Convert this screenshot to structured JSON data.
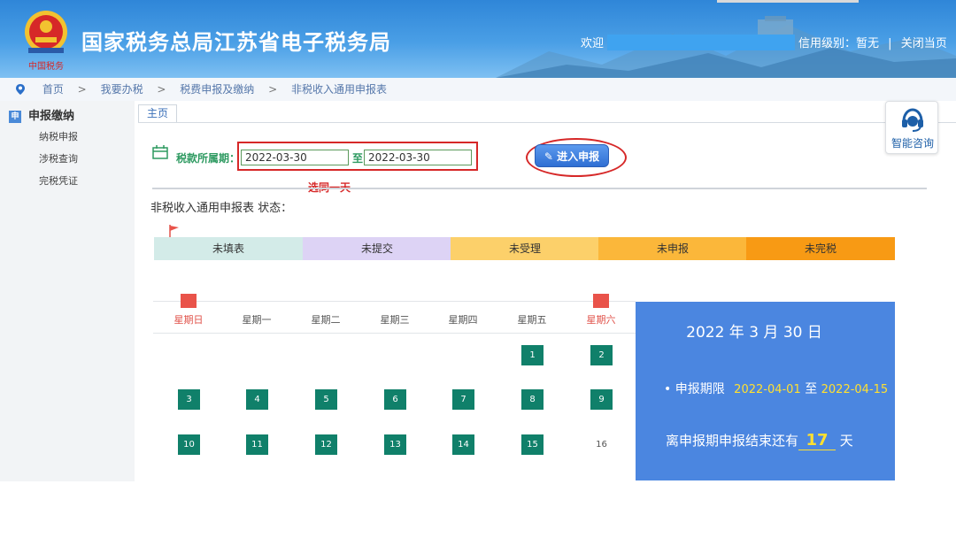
{
  "header": {
    "title": "国家税务总局江苏省电子税务局",
    "welcome": "欢迎",
    "credit_text": "信用级别：暂无",
    "divider": "|",
    "close_label": "关闭当页"
  },
  "breadcrumb": {
    "items": [
      "首页",
      "我要办税",
      "税费申报及缴纳",
      "非税收入通用申报表"
    ],
    "separator": ">"
  },
  "sidebar": {
    "head_icon": "申",
    "head_label": "申报缴纳",
    "items": [
      "纳税申报",
      "涉税查询",
      "完税凭证"
    ]
  },
  "tabs": [
    "主页"
  ],
  "filter": {
    "period_label": "税款所属期：",
    "start": "2022-03-30",
    "to_label": "至",
    "end": "2022-03-30",
    "annotation": "选同一天",
    "enter_button": "进入申报"
  },
  "status": {
    "title": "非税收入通用申报表 状态：",
    "stages": [
      {
        "label": "未填表",
        "color": "#d3ebe8"
      },
      {
        "label": "未提交",
        "color": "#ddd3f5"
      },
      {
        "label": "未受理",
        "color": "#fcd06a"
      },
      {
        "label": "未申报",
        "color": "#fbb73a"
      },
      {
        "label": "未完税",
        "color": "#f89a14"
      }
    ]
  },
  "assistant": {
    "label": "智能咨询",
    "icon": "headset-icon"
  },
  "calendar": {
    "weekdays": [
      "星期日",
      "星期一",
      "星期二",
      "星期三",
      "星期四",
      "星期五",
      "星期六"
    ],
    "week1": [
      "",
      "",
      "",
      "",
      "",
      "1",
      "2"
    ],
    "week2": [
      "3",
      "4",
      "5",
      "6",
      "7",
      "8",
      "9"
    ],
    "week3": [
      "10",
      "11",
      "12",
      "13",
      "14",
      "15",
      "16"
    ]
  },
  "info": {
    "date_text": "2022 年 3 月 30 日",
    "period_label": "申报期限",
    "period_start": "2022-04-01",
    "period_to": "至",
    "period_end": "2022-04-15",
    "remain_prefix": "离申报期申报结束还有",
    "remain_days": "17",
    "remain_suffix": "天"
  },
  "colors": {
    "accent": "#2f86d8",
    "highlight": "#d62828",
    "day_cell": "#10806a",
    "info_panel": "#4b86e0"
  }
}
